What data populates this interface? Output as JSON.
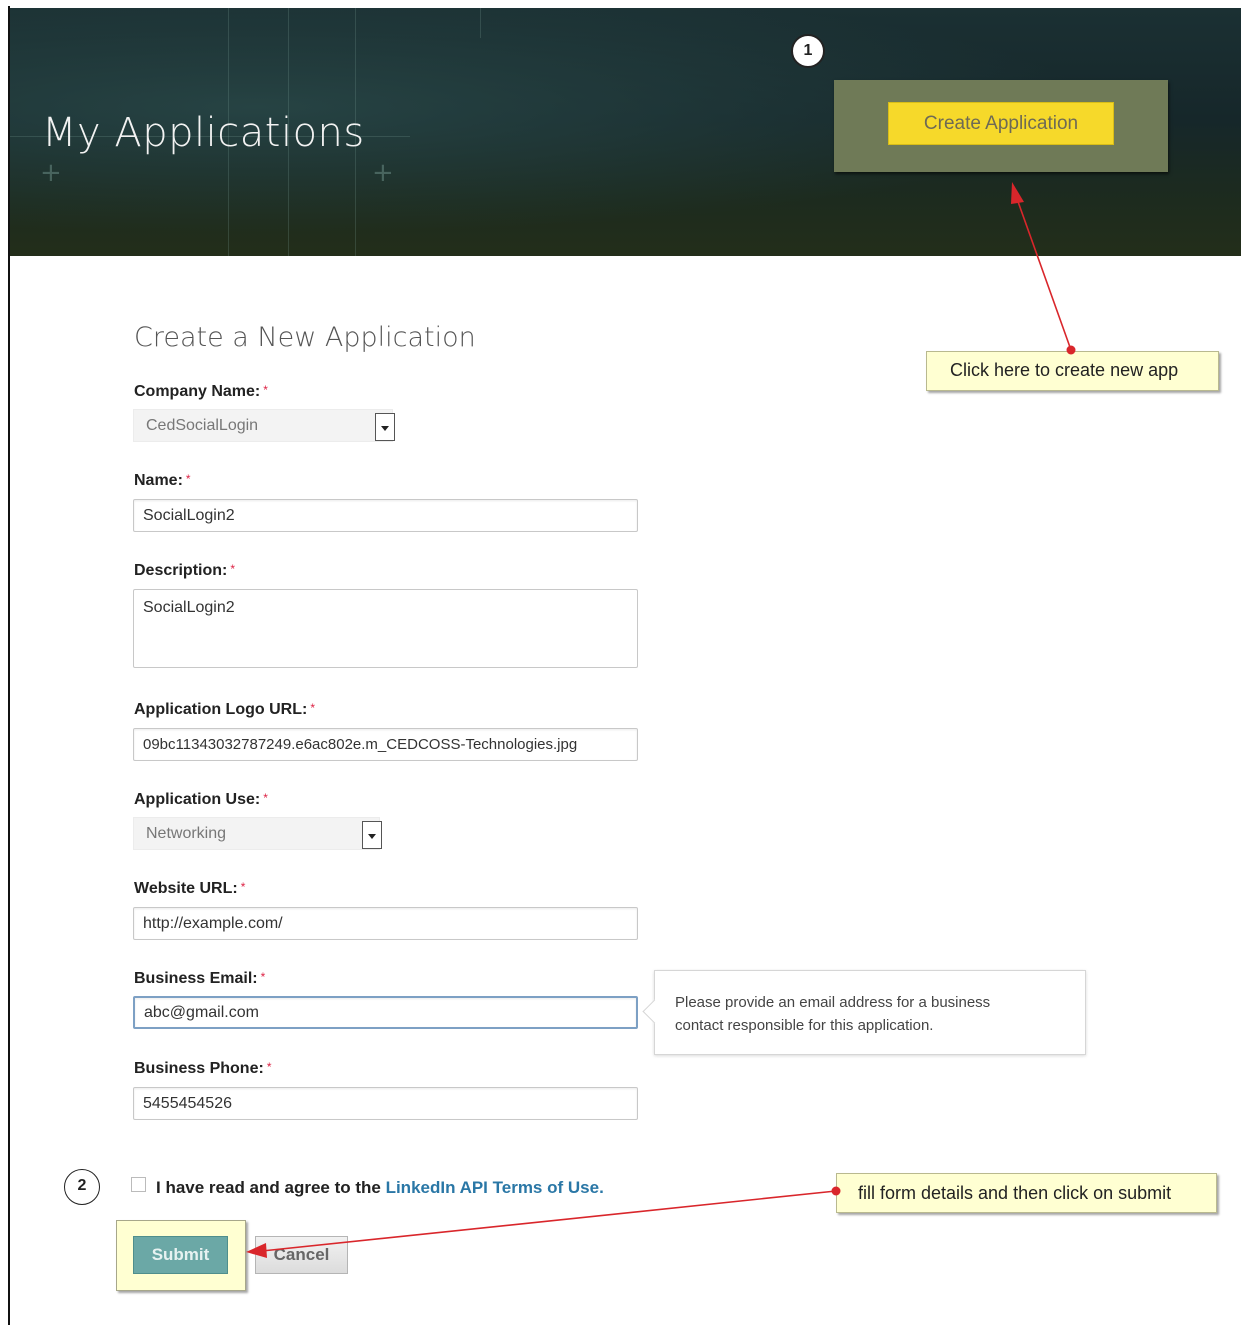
{
  "header": {
    "title": "My Applications",
    "create_button_label": "Create Application",
    "step_badge": "1"
  },
  "callouts": {
    "create_hint": "Click here to create new app",
    "submit_hint": "fill form details and then click on submit",
    "step_badge": "2"
  },
  "form": {
    "title": "Create a New Application",
    "required_marker": "*",
    "company_name": {
      "label": "Company Name:",
      "value": "CedSocialLogin"
    },
    "name": {
      "label": "Name:",
      "value": "SocialLogin2"
    },
    "description": {
      "label": "Description:",
      "value": "SocialLogin2"
    },
    "logo_url": {
      "label": "Application Logo URL:",
      "value": "09bc11343032787249.e6ac802e.m_CEDCOSS-Technologies.jpg"
    },
    "application_use": {
      "label": "Application Use:",
      "value": "Networking"
    },
    "website_url": {
      "label": "Website URL:",
      "value": "http://example.com/"
    },
    "business_email": {
      "label": "Business Email:",
      "value": "abc@gmail.com",
      "tooltip_line1": "Please provide an email address for a business",
      "tooltip_line2": "contact responsible for this application."
    },
    "business_phone": {
      "label": "Business Phone:",
      "value": "5455454526"
    },
    "terms": {
      "text": "I have read and agree to the ",
      "link": "LinkedIn API Terms of Use."
    },
    "submit_label": "Submit",
    "cancel_label": "Cancel"
  },
  "colors": {
    "header_bg": "#1b3033",
    "create_button": "#f6d92a",
    "callout_bg": "#ffffd2",
    "submit_button": "#6ba8a6",
    "link": "#2a77a6",
    "arrow": "#d9262b"
  }
}
